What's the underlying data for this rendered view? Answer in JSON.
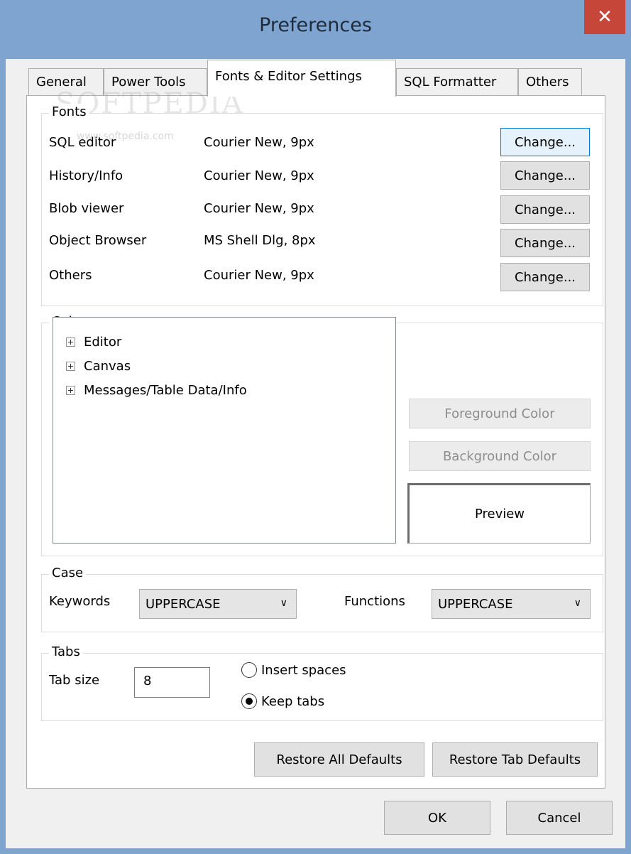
{
  "window": {
    "title": "Preferences",
    "close_glyph": "✕"
  },
  "tabs": [
    {
      "label": "General"
    },
    {
      "label": "Power Tools"
    },
    {
      "label": "Fonts & Editor Settings"
    },
    {
      "label": "SQL Formatter"
    },
    {
      "label": "Others"
    }
  ],
  "watermark": {
    "text": "SOFTPEDIA",
    "url": "www.softpedia.com"
  },
  "fonts_group": {
    "label": "Fonts",
    "rows": [
      {
        "name": "SQL editor",
        "value": "Courier New, 9px",
        "button": "Change..."
      },
      {
        "name": "History/Info",
        "value": "Courier New, 9px",
        "button": "Change..."
      },
      {
        "name": "Blob viewer",
        "value": "Courier New, 9px",
        "button": "Change..."
      },
      {
        "name": "Object Browser",
        "value": "MS Shell Dlg, 8px",
        "button": "Change..."
      },
      {
        "name": "Others",
        "value": "Courier New, 9px",
        "button": "Change..."
      }
    ]
  },
  "color_group": {
    "label": "Color",
    "tree_items": [
      "Editor",
      "Canvas",
      "Messages/Table Data/Info"
    ],
    "foreground_button": "Foreground Color",
    "background_button": "Background Color",
    "preview_label": "Preview"
  },
  "case_group": {
    "label": "Case",
    "keywords_label": "Keywords",
    "keywords_value": "UPPERCASE",
    "functions_label": "Functions",
    "functions_value": "UPPERCASE",
    "chevron": "∨"
  },
  "tabs_group": {
    "label": "Tabs",
    "tab_size_label": "Tab size",
    "tab_size_value": "8",
    "insert_spaces_label": "Insert spaces",
    "keep_tabs_label": "Keep tabs",
    "selected": "keep_tabs"
  },
  "buttons": {
    "restore_all": "Restore All Defaults",
    "restore_tab": "Restore Tab Defaults",
    "ok": "OK",
    "cancel": "Cancel"
  },
  "colors": {
    "title_bar": "#7fa4d0",
    "close_button": "#c7463a"
  }
}
